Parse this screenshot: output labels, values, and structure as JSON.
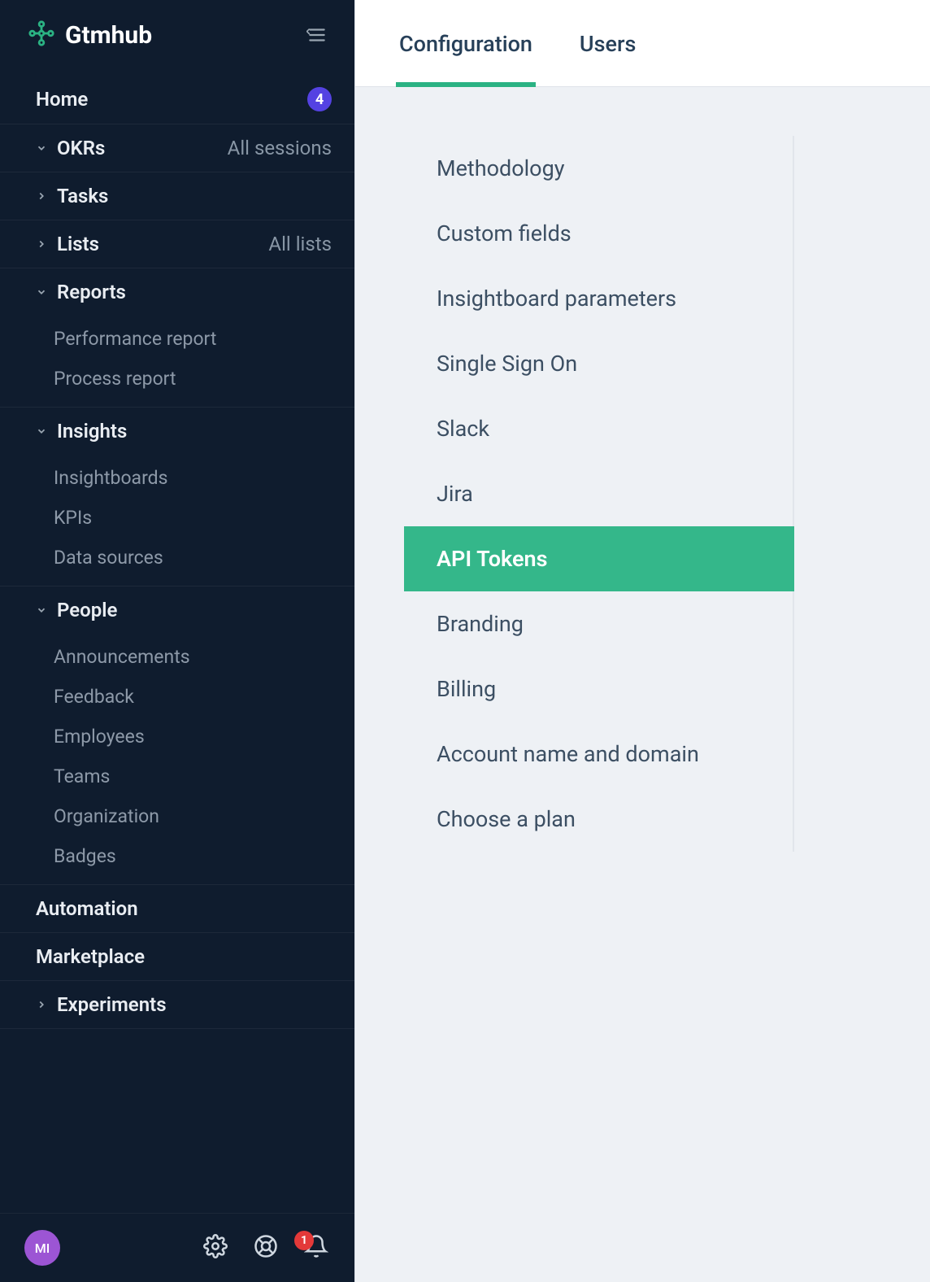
{
  "brand": {
    "name": "Gtmhub"
  },
  "sidebar": {
    "home": {
      "label": "Home",
      "badge": "4"
    },
    "okrs": {
      "label": "OKRs",
      "secondary": "All sessions"
    },
    "tasks": {
      "label": "Tasks"
    },
    "lists": {
      "label": "Lists",
      "secondary": "All lists"
    },
    "reports": {
      "label": "Reports",
      "items": [
        "Performance report",
        "Process report"
      ]
    },
    "insights": {
      "label": "Insights",
      "items": [
        "Insightboards",
        "KPIs",
        "Data sources"
      ]
    },
    "people": {
      "label": "People",
      "items": [
        "Announcements",
        "Feedback",
        "Employees",
        "Teams",
        "Organization",
        "Badges"
      ]
    },
    "automation": {
      "label": "Automation"
    },
    "marketplace": {
      "label": "Marketplace"
    },
    "experiments": {
      "label": "Experiments"
    }
  },
  "footer": {
    "avatar_initials": "MI",
    "notification_count": "1"
  },
  "tabs": {
    "configuration": "Configuration",
    "users": "Users"
  },
  "config_menu": {
    "items": [
      "Methodology",
      "Custom fields",
      "Insightboard parameters",
      "Single Sign On",
      "Slack",
      "Jira",
      "API Tokens",
      "Branding",
      "Billing",
      "Account name and domain",
      "Choose a plan"
    ],
    "selected_index": 6
  }
}
